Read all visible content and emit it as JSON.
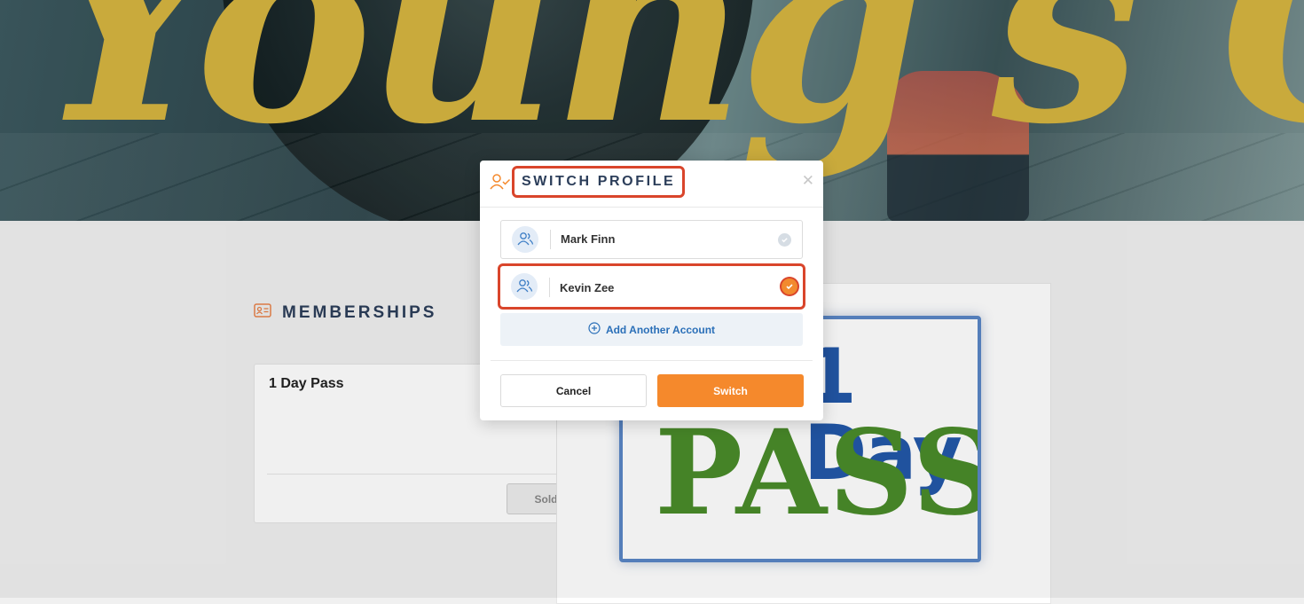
{
  "hero": {
    "brand_text": "Young's Gym"
  },
  "section": {
    "title": "MEMBERSHIPS",
    "icon": "id-card-icon"
  },
  "membership_card": {
    "title": "1 Day Pass",
    "status_button": "Sold Out"
  },
  "pass_image": {
    "line1": "1 Day",
    "line2": "PASS"
  },
  "modal": {
    "title": "SWITCH PROFILE",
    "title_icon": "user-check-icon",
    "close_icon": "close-icon",
    "profiles": [
      {
        "name": "Mark Finn",
        "selected": false,
        "icon": "users-icon"
      },
      {
        "name": "Kevin Zee",
        "selected": true,
        "icon": "users-icon"
      }
    ],
    "add_account_label": "Add Another Account",
    "cancel_label": "Cancel",
    "switch_label": "Switch"
  },
  "colors": {
    "accent": "#f5892c",
    "highlight": "#d9452b",
    "link": "#2a6fb8",
    "brand_gold": "#d6b540"
  }
}
